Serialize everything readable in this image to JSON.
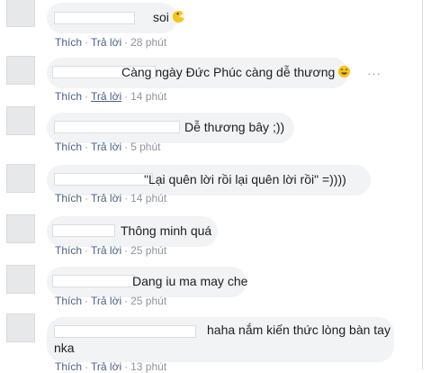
{
  "comments": [
    {
      "text": "soi",
      "emoji": "pacman-emoji",
      "like": "Thích",
      "reply": "Trả lời",
      "time": "28 phút"
    },
    {
      "text": "Càng ngày Đức Phúc càng dễ thương",
      "emoji": "laughing-face-emoji",
      "like": "Thích",
      "reply": "Trả lời",
      "time": "14 phút",
      "more": "···"
    },
    {
      "text": "Dễ thương bây ;))",
      "like": "Thích",
      "reply": "Trả lời",
      "time": "5 phút"
    },
    {
      "text": "\"Lại quên lời rồi lại quên lời rồi\" =))))",
      "like": "Thích",
      "reply": "Trả lời",
      "time": "14 phút"
    },
    {
      "text": "Thông minh quá",
      "like": "Thích",
      "reply": "Trả lời",
      "time": "25 phút"
    },
    {
      "text": "Dang iu ma may che",
      "like": "Thích",
      "reply": "Trả lời",
      "time": "25 phút"
    },
    {
      "text": "haha nắm kiến thức lòng bàn tay",
      "text2": "nka",
      "like": "Thích",
      "reply": "Trả lời",
      "time": "13 phút"
    }
  ],
  "separator": "·"
}
